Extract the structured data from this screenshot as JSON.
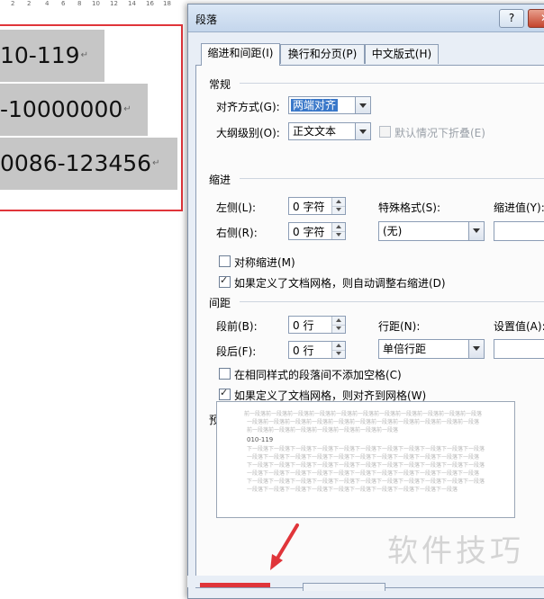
{
  "ruler": {
    "numbers": [
      "2",
      "2",
      "4",
      "6",
      "8",
      "10",
      "12",
      "14",
      "16",
      "18"
    ]
  },
  "document": {
    "lines": [
      "10-119",
      "-10000000",
      "0086-123456"
    ],
    "para_mark": "↵"
  },
  "dialog": {
    "title": "段落",
    "help_label": "?",
    "close_label": "✕",
    "tabs": [
      "缩进和间距(I)",
      "换行和分页(P)",
      "中文版式(H)"
    ],
    "general": {
      "section": "常规",
      "alignment_label": "对齐方式(G):",
      "alignment_value": "两端对齐",
      "outline_label": "大纲级别(O):",
      "outline_value": "正文文本",
      "collapse_label": "默认情况下折叠(E)"
    },
    "indent": {
      "section": "缩进",
      "left_label": "左侧(L):",
      "left_value": "0 字符",
      "right_label": "右侧(R):",
      "right_value": "0 字符",
      "special_label": "特殊格式(S):",
      "special_value": "(无)",
      "by_label": "缩进值(Y):",
      "mirror_label": "对称缩进(M)",
      "auto_adjust_label": "如果定义了文档网格，则自动调整右缩进(D)"
    },
    "spacing": {
      "section": "间距",
      "before_label": "段前(B):",
      "before_value": "0 行",
      "after_label": "段后(F):",
      "after_value": "0 行",
      "line_spacing_label": "行距(N):",
      "line_spacing_value": "单倍行距",
      "at_label": "设置值(A):",
      "no_space_same_style_label": "在相同样式的段落间不添加空格(C)",
      "snap_to_grid_label": "如果定义了文档网格，则对齐到网格(W)"
    },
    "preview": {
      "section": "预览",
      "before_lines": [
        "前一段落前一段落前一段落前一段落前一段落前一段落前一段落前一段落前一段落前一段落前一段落",
        "一段落前一段落前一段落前一段落前一段落前一段落前一段落前一段落前一段落前一段落前一段落",
        "前一段落前一段落前一段落前一段落前一段落前一段落前一段落"
      ],
      "sample": "010-119",
      "after_lines": [
        "下一段落下一段落下一段落下一段落下一段落下一段落下一段落下一段落下一段落下一段落下一段落",
        "一段落下一段落下一段落下一段落下一段落下一段落下一段落下一段落下一段落下一段落下一段落",
        "下一段落下一段落下一段落下一段落下一段落下一段落下一段落下一段落下一段落下一段落下一段落",
        "一段落下一段落下一段落下一段落下一段落下一段落下一段落下一段落下一段落下一段落下一段落",
        "下一段落下一段落下一段落下一段落下一段落下一段落下一段落下一段落下一段落下一段落下一段落",
        "一段落下一段落下一段落下一段落下一段落下一段落下一段落下一段落下一段落下一段落"
      ]
    }
  },
  "watermark": "软件技巧",
  "colors": {
    "annotation_red": "#e0353a",
    "selection_blue": "#3a78c9"
  }
}
